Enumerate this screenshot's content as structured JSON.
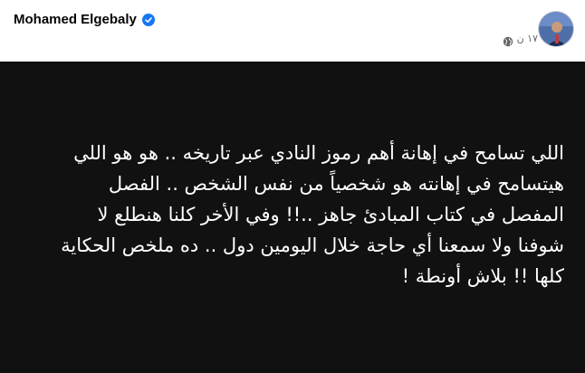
{
  "author": {
    "name": "Mohamed Elgebaly",
    "verified_icon": "verified-badge-icon"
  },
  "meta": {
    "time": "١٧ ن",
    "audience_icon": "globe-icon"
  },
  "colors": {
    "background_post": "#111111",
    "text": "#ffffff",
    "verified": "#1877f2",
    "meta_text": "#65676b"
  },
  "post": {
    "text": "اللي تسامح في إهانة أهم رموز النادي عبر تاريخه .. هو هو اللي\nهيتسامح في إهانته هو شخصياً من نفس الشخص .. الفصل\nالمفصل في كتاب المبادئ جاهز ..!! وفي الأخر كلنا هنطلع لا\nشوفنا ولا سمعنا أي حاجة خلال اليومين دول .. ده ملخص الحكاية\nكلها !! بلاش أونطة !"
  }
}
